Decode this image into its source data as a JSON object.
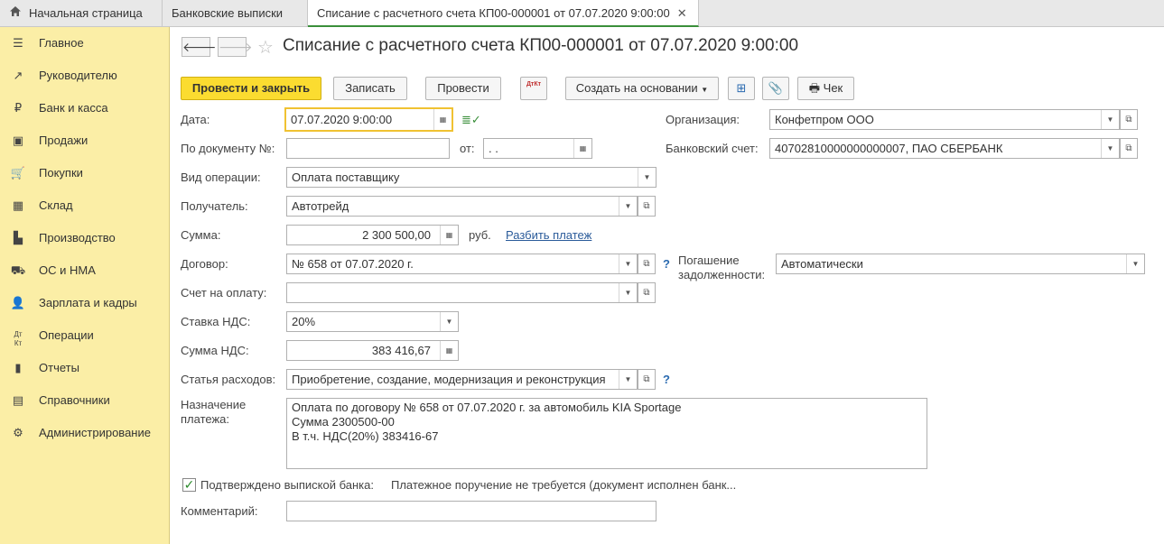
{
  "tabs": [
    {
      "label": "Начальная страница"
    },
    {
      "label": "Банковские выписки"
    },
    {
      "label": "Списание с расчетного счета КП00-000001 от 07.07.2020 9:00:00"
    }
  ],
  "sidebar": {
    "items": [
      {
        "label": "Главное",
        "icon": "menu-icon"
      },
      {
        "label": "Руководителю",
        "icon": "trend-icon"
      },
      {
        "label": "Банк и касса",
        "icon": "ruble-icon"
      },
      {
        "label": "Продажи",
        "icon": "bag-icon"
      },
      {
        "label": "Покупки",
        "icon": "cart-icon"
      },
      {
        "label": "Склад",
        "icon": "grid-icon"
      },
      {
        "label": "Производство",
        "icon": "factory-icon"
      },
      {
        "label": "ОС и НМА",
        "icon": "truck-icon"
      },
      {
        "label": "Зарплата и кадры",
        "icon": "person-icon"
      },
      {
        "label": "Операции",
        "icon": "dt-kt-icon"
      },
      {
        "label": "Отчеты",
        "icon": "bar-chart-icon"
      },
      {
        "label": "Справочники",
        "icon": "books-icon"
      },
      {
        "label": "Администрирование",
        "icon": "gear-icon"
      }
    ]
  },
  "header": {
    "title": "Списание с расчетного счета КП00-000001 от 07.07.2020 9:00:00"
  },
  "toolbar": {
    "post_close": "Провести и закрыть",
    "save": "Записать",
    "post": "Провести",
    "dt_kt": "ДтКт",
    "create_based": "Создать на основании",
    "check": "Чек"
  },
  "form": {
    "date_label": "Дата:",
    "date_value": "07.07.2020  9:00:00",
    "doc_num_label": "По документу №:",
    "doc_num_value": "",
    "from_label": "от:",
    "from_value": " .  .",
    "op_type_label": "Вид операции:",
    "op_type_value": "Оплата поставщику",
    "recipient_label": "Получатель:",
    "recipient_value": "Автотрейд",
    "sum_label": "Сумма:",
    "sum_value": "2 300 500,00",
    "currency": "руб.",
    "split_link": "Разбить платеж",
    "contract_label": "Договор:",
    "contract_value": "№ 658 от 07.07.2020 г.",
    "invoice_label": "Счет на оплату:",
    "invoice_value": "",
    "vat_rate_label": "Ставка НДС:",
    "vat_rate_value": "20%",
    "vat_sum_label": "Сумма НДС:",
    "vat_sum_value": "383 416,67",
    "expense_label": "Статья расходов:",
    "expense_value": "Приобретение, создание, модернизация и реконструкция",
    "purpose_label_1": "Назначение",
    "purpose_label_2": "платежа:",
    "purpose_lines": [
      "Оплата по договору № 658 от 07.07.2020 г. за автомобиль KIA Sportage",
      "Сумма 2300500-00",
      "В т.ч. НДС(20%) 383416-67"
    ],
    "confirmed_label": "Подтверждено выпиской банка:",
    "payment_order_text": "Платежное поручение не требуется (документ исполнен банк...",
    "comment_label": "Комментарий:",
    "comment_value": "",
    "org_label": "Организация:",
    "org_value": "Конфетпром ООО",
    "bank_account_label": "Банковский счет:",
    "bank_account_value": "40702810000000000007, ПАО СБЕРБАНК",
    "debt_label_1": "Погашение",
    "debt_label_2": "задолженности:",
    "debt_value": "Автоматически",
    "help": "?"
  },
  "colors": {
    "sidebar_bg": "#fbeea6",
    "primary_button": "#fbdc30",
    "focus_border": "#f0c232",
    "link": "#2a5b9a"
  }
}
